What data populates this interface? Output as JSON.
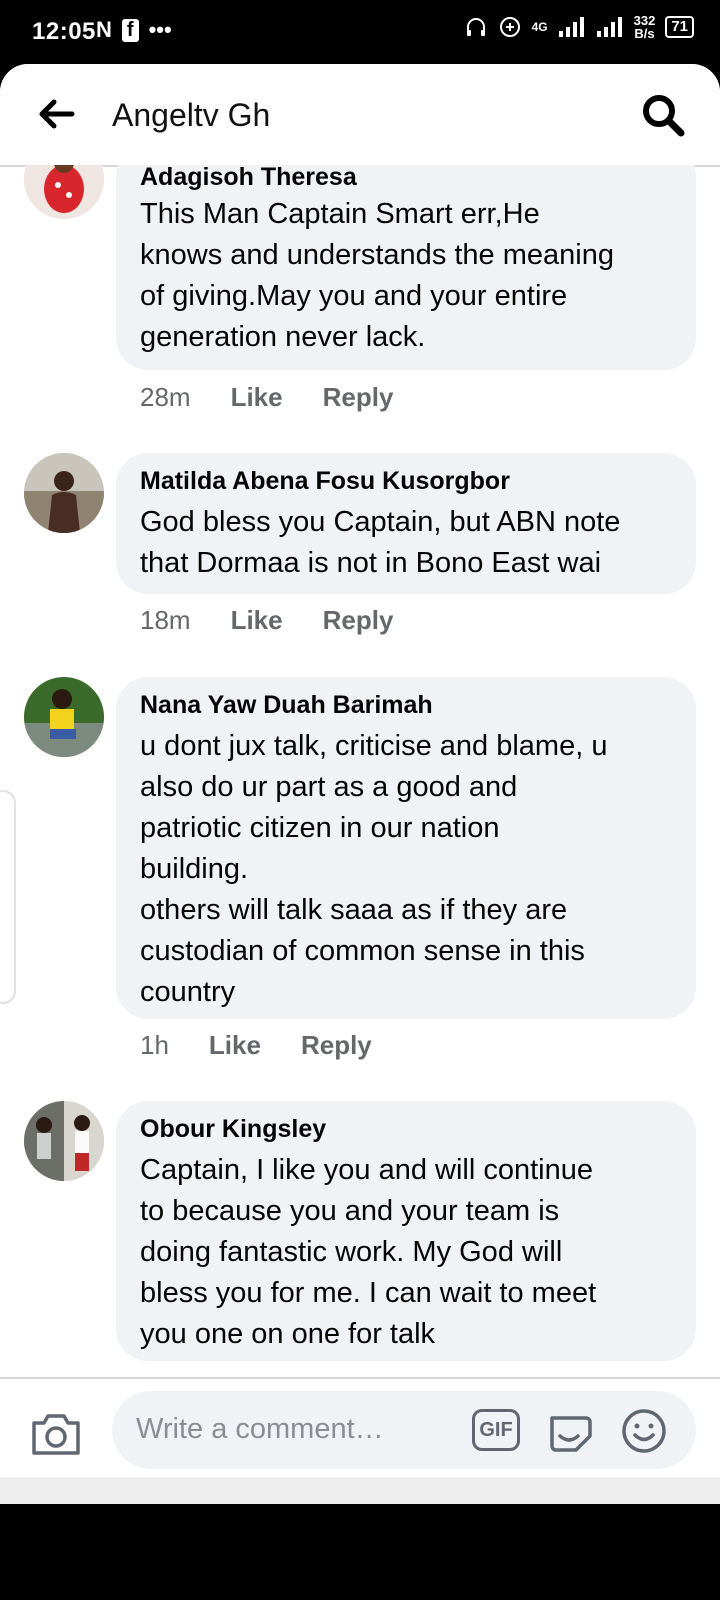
{
  "status_bar": {
    "time": "12:05",
    "app_icons": [
      "N",
      "f",
      "•••"
    ],
    "network": "4G",
    "speed_value": "332",
    "speed_unit": "B/s",
    "battery": "71"
  },
  "header": {
    "title": "Angeltv Gh",
    "back_icon": "arrow-left-icon",
    "search_icon": "search-icon"
  },
  "comments": [
    {
      "author": "Adagisoh Theresa",
      "text": "This Man Captain Smart err,He\nknows and understands the meaning\nof giving.May you and your entire\ngeneration never lack.",
      "time": "28m",
      "like": "Like",
      "reply": "Reply"
    },
    {
      "author": "Matilda Abena Fosu Kusorgbor",
      "text": "God bless you Captain, but ABN note\nthat Dormaa is not in Bono East wai",
      "time": "18m",
      "like": "Like",
      "reply": "Reply"
    },
    {
      "author": "Nana Yaw Duah Barimah",
      "text": "u dont jux talk, criticise and blame, u\nalso do ur part as a good and\npatriotic citizen in our nation\nbuilding.\nothers will talk saaa as if they are\ncustodian of common sense in this\ncountry",
      "time": "1h",
      "like": "Like",
      "reply": "Reply"
    },
    {
      "author": "Obour Kingsley",
      "text": "Captain, I like you and will continue\nto because you and your team is\ndoing fantastic work.  My God will\nbless you for me. I can wait to meet\nyou one on one for talk",
      "time": "",
      "like": "",
      "reply": ""
    }
  ],
  "composer": {
    "placeholder": "Write a comment…",
    "gif_label": "GIF",
    "camera_icon": "camera-icon",
    "sticker_icon": "sticker-icon",
    "emoji_icon": "emoji-icon"
  },
  "navbar": {
    "recents_icon": "square-icon",
    "home_icon": "circle-icon",
    "back_icon": "triangle-back-icon"
  },
  "colors": {
    "bubble": "#f0f2f5",
    "secondary_text": "#65676b",
    "primary_text": "#050505"
  }
}
